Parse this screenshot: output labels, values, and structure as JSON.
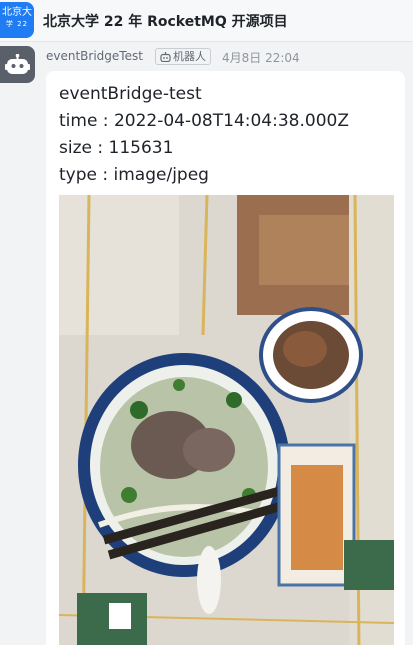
{
  "header": {
    "avatar_line1": "北京大",
    "avatar_line2": "学 22",
    "title": "北京大学 22 年 RocketMQ 开源项目"
  },
  "message": {
    "sender": "eventBridgeTest",
    "tag_icon": "robot-icon",
    "tag_label": "机器人",
    "time": "4月8日 22:04",
    "lines": [
      "eventBridge-test",
      "time : 2022-04-08T14:04:38.000Z",
      "size : 115631",
      "type : image/jpeg"
    ],
    "image_icon": "food-photo"
  },
  "colors": {
    "group_avatar": "#1f7cf2",
    "bot_avatar": "#5a6069",
    "background": "#f2f3f5"
  }
}
